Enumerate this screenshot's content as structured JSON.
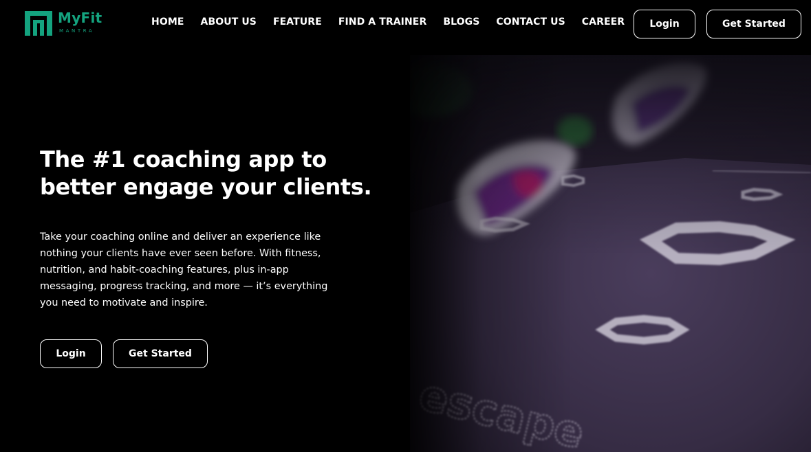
{
  "brand": {
    "name": "MyFit",
    "subtitle": "MANTRA",
    "color": "#14a37f"
  },
  "nav": {
    "items": [
      {
        "label": "HOME"
      },
      {
        "label": "ABOUT US"
      },
      {
        "label": "FEATURE"
      },
      {
        "label": "FIND A TRAINER"
      },
      {
        "label": "BLOGS"
      },
      {
        "label": "CONTACT US"
      },
      {
        "label": "CAREER"
      }
    ]
  },
  "header_actions": {
    "login_label": "Login",
    "get_started_label": "Get Started"
  },
  "hero": {
    "title_line1": "The #1 coaching app to",
    "title_line2": "better engage your clients.",
    "description": "Take your coaching online and deliver an experience like nothing your clients have ever seen before. With fitness, nutrition, and habit-coaching features, plus in-app messaging, progress tracking, and more — it’s everything you need to motivate and inspire.",
    "login_label": "Login",
    "get_started_label": "Get Started",
    "image_mat_text": "escape"
  },
  "colors": {
    "background": "#000000",
    "text": "#ffffff",
    "image_tone": "#3b2f4a"
  }
}
